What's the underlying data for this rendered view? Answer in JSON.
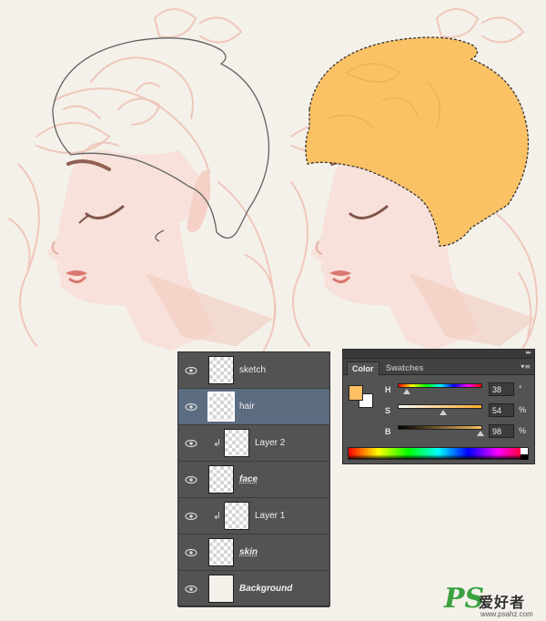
{
  "layers_panel": {
    "layers": [
      {
        "name": "sketch",
        "style": "normal",
        "clipped": false,
        "selected": false,
        "thumb": "checker"
      },
      {
        "name": "hair",
        "style": "normal",
        "clipped": false,
        "selected": true,
        "thumb": "checker"
      },
      {
        "name": "Layer 2",
        "style": "normal",
        "clipped": true,
        "selected": false,
        "thumb": "checker"
      },
      {
        "name": "face",
        "style": "italic-underline",
        "clipped": false,
        "selected": false,
        "thumb": "checker"
      },
      {
        "name": "Layer 1",
        "style": "normal",
        "clipped": true,
        "selected": false,
        "thumb": "checker"
      },
      {
        "name": "skin",
        "style": "italic-underline",
        "clipped": false,
        "selected": false,
        "thumb": "checker"
      },
      {
        "name": "Background",
        "style": "italic",
        "clipped": false,
        "selected": false,
        "thumb": "solid"
      }
    ],
    "eye_icon": "eye-icon",
    "clip_icon": "clipping-arrow-icon"
  },
  "color_panel": {
    "tabs": [
      "Color",
      "Swatches"
    ],
    "active_tab": "Color",
    "foreground_color": "#fdc063",
    "background_color": "#ffffff",
    "channels": [
      {
        "label": "H",
        "value": "38",
        "unit": "°",
        "fraction": 0.106
      },
      {
        "label": "S",
        "value": "54",
        "unit": "%",
        "fraction": 0.54
      },
      {
        "label": "B",
        "value": "98",
        "unit": "%",
        "fraction": 0.98
      }
    ],
    "collapse_icon": "double-chevron-right-icon",
    "menu_icon": "panel-menu-icon"
  },
  "watermark": {
    "logo": "PS",
    "text": "爱好者",
    "url": "www.psahz.com"
  },
  "colors": {
    "canvas_bg": "#f4f1ea",
    "hair_fill": "#fbc05e",
    "sketch_line": "#eec3b8",
    "panel_bg": "#535353",
    "selected_row": "#5b6b80"
  }
}
